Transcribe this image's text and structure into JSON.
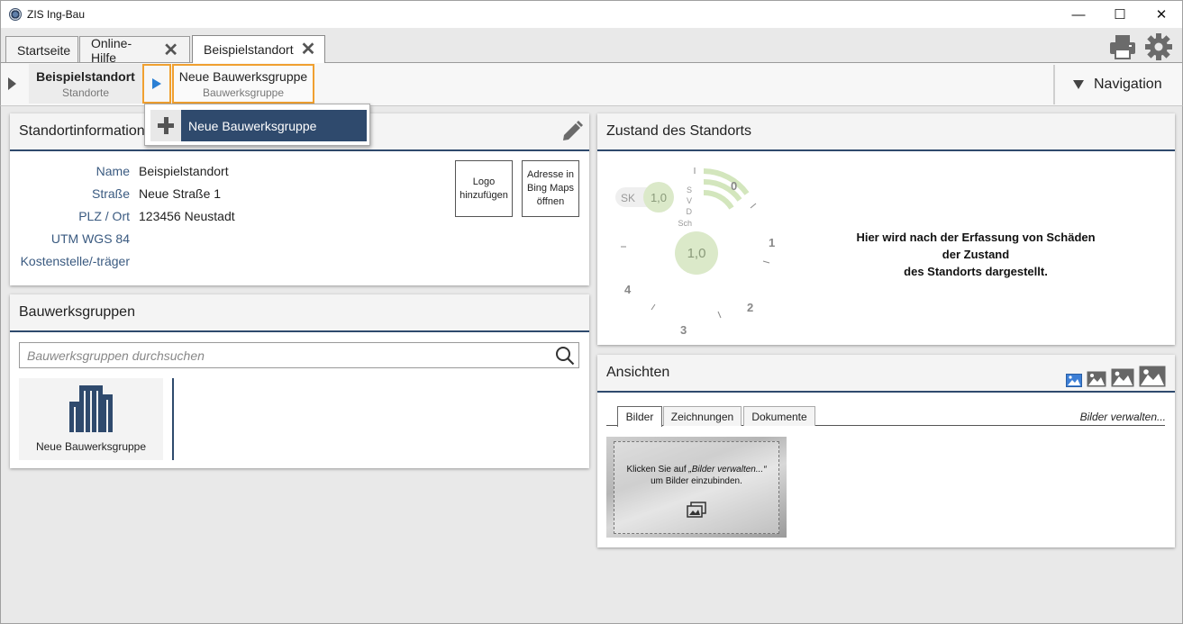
{
  "window": {
    "title": "ZIS Ing-Bau",
    "minimize": "—",
    "maximize": "☐",
    "close": "✕"
  },
  "tabs": [
    {
      "label": "Startseite",
      "closable": false
    },
    {
      "label": "Online-Hilfe",
      "closable": true
    },
    {
      "label": "Beispielstandort",
      "closable": true,
      "active": true
    }
  ],
  "toolbar_icons": [
    "printer-icon",
    "gear-icon"
  ],
  "breadcrumb": {
    "items": [
      {
        "title": "Beispielstandort",
        "subtitle": "Standorte"
      },
      {
        "title": "Neue Bauwerksgruppe",
        "subtitle": "Bauwerksgruppe"
      }
    ],
    "navigation_label": "Navigation"
  },
  "popup": {
    "item_label": "Neue Bauwerksgruppe"
  },
  "standortinfo": {
    "title": "Standortinformation",
    "rows": [
      {
        "label": "Name",
        "value": "Beispielstandort"
      },
      {
        "label": "Straße",
        "value": "Neue Straße 1"
      },
      {
        "label": "PLZ / Ort",
        "value": "123456 Neustadt"
      },
      {
        "label": "UTM WGS 84",
        "value": ""
      },
      {
        "label": "Kostenstelle/-träger",
        "value": ""
      }
    ],
    "logo_button": "Logo hinzufügen",
    "map_button": "Adresse in Bing Maps öffnen"
  },
  "bauwerksgruppen": {
    "title": "Bauwerksgruppen",
    "search_placeholder": "Bauwerksgruppen durchsuchen",
    "tiles": [
      {
        "label": "Neue Bauwerksgruppe"
      }
    ]
  },
  "zustand": {
    "title": "Zustand des Standorts",
    "gauge": {
      "sk_label": "SK",
      "sk_value": "1,0",
      "svd_labels": [
        "S",
        "V",
        "D",
        "Sch"
      ],
      "main_value": "1,0",
      "scale": [
        "0",
        "1",
        "2",
        "3",
        "4"
      ]
    },
    "message_lines": [
      "Hier wird nach der Erfassung von Schäden",
      "der Zustand",
      "des Standorts dargestellt."
    ]
  },
  "ansichten": {
    "title": "Ansichten",
    "tabs": [
      "Bilder",
      "Zeichnungen",
      "Dokumente"
    ],
    "manage_link": "Bilder verwalten...",
    "placeholder_prefix": "Klicken Sie auf ",
    "placeholder_link": "„Bilder verwalten...“",
    "placeholder_suffix": "um Bilder einzubinden."
  },
  "colors": {
    "accent_dark_blue": "#2f4a6d",
    "label_blue": "#3a5a80",
    "highlight_orange": "#f0a030",
    "play_blue": "#2a7fd4",
    "gauge_green": "#c8e0a8"
  }
}
